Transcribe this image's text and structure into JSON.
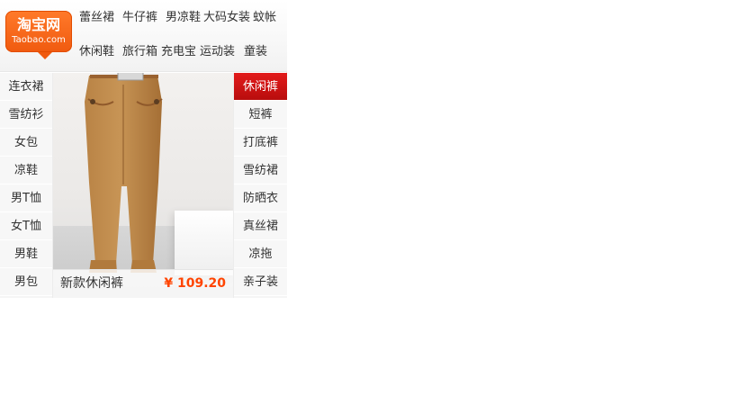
{
  "header": {
    "logo": {
      "name": "淘宝网",
      "domain": "Taobao.com"
    },
    "top_categories": [
      "蕾丝裙",
      "牛仔裤",
      "男凉鞋",
      "大码女装",
      "蚊帐",
      "休闲鞋",
      "旅行箱",
      "充电宝",
      "运动装",
      "童装"
    ]
  },
  "left_categories": [
    "连衣裙",
    "雪纺衫",
    "女包",
    "凉鞋",
    "男T恤",
    "女T恤",
    "男鞋",
    "男包"
  ],
  "right_categories": [
    "休闲裤",
    "短裤",
    "打底裤",
    "雪纺裙",
    "防晒衣",
    "真丝裙",
    "凉拖",
    "亲子装"
  ],
  "active_category": "休闲裤",
  "product": {
    "name": "新款休闲裤",
    "price": "¥ 109.20",
    "image": "khaki-pants-photo"
  },
  "colors": {
    "brand": "#f05a0f",
    "active_tab": "#d31616",
    "price": "#ff4400"
  }
}
